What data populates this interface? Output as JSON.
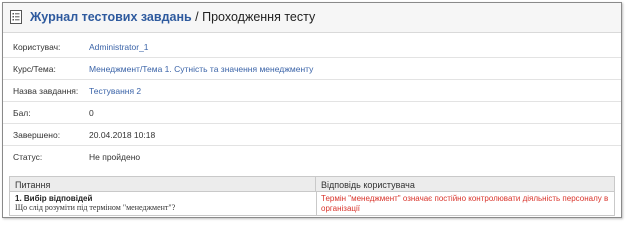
{
  "header": {
    "journal_link": "Журнал тестових завдань",
    "separator": " / ",
    "current_page": "Проходження тесту"
  },
  "info_rows": [
    {
      "label": "Користувач:",
      "value": "Administrator_1"
    },
    {
      "label": "Курс/Тема:",
      "value": "Менеджмент/Тема 1. Сутність та значення менеджменту"
    },
    {
      "label": "Назва завдання:",
      "value": "Тестування 2"
    },
    {
      "label": "Бал:",
      "value": "0"
    },
    {
      "label": "Завершено:",
      "value": "20.04.2018 10:18"
    },
    {
      "label": "Статус:",
      "value": "Не пройдено"
    }
  ],
  "answers_table": {
    "headers": {
      "question": "Питання",
      "answer": "Відповідь користувача"
    },
    "rows": [
      {
        "question_title": "1. Вибір відповідей",
        "question_text": "Що слід розуміти під терміном \"менеджмент\"?",
        "user_answer": "Термін \"менеджмент\" означає постійно контролювати діяльність персоналу в організації"
      }
    ]
  },
  "colors": {
    "link": "#2e5a9e",
    "wrong_answer": "#d9342b",
    "header_bg": "#f6f6f6"
  }
}
